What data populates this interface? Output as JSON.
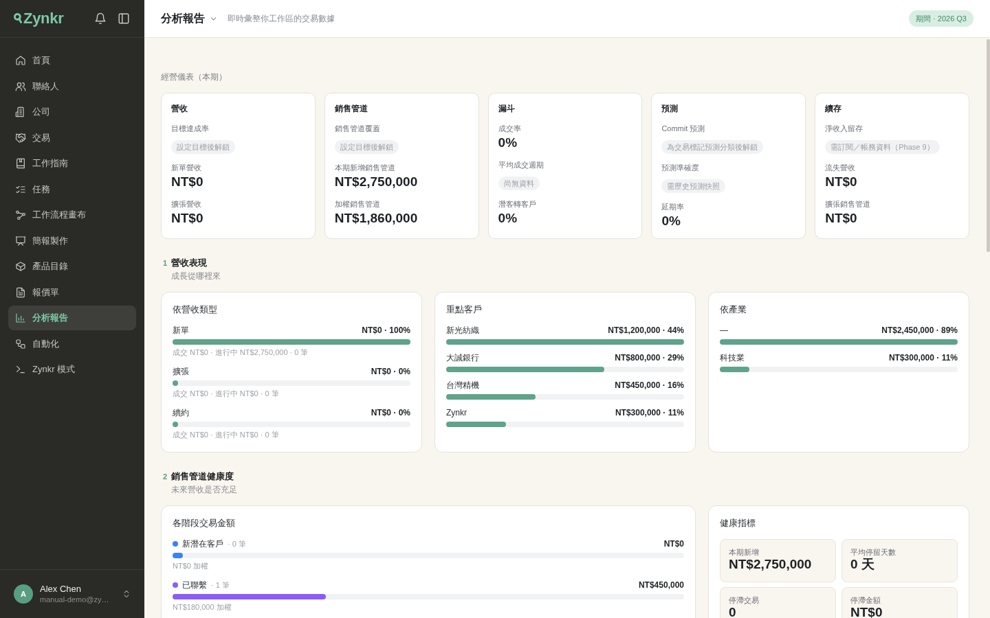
{
  "sidebar": {
    "logo": "Zynkr",
    "items": [
      {
        "label": "首頁",
        "selected": false
      },
      {
        "label": "聯絡人",
        "selected": false
      },
      {
        "label": "公司",
        "selected": false
      },
      {
        "label": "交易",
        "selected": false
      },
      {
        "label": "工作指南",
        "selected": false
      },
      {
        "label": "任務",
        "selected": false
      },
      {
        "label": "工作流程畫布",
        "selected": false
      },
      {
        "label": "簡報製作",
        "selected": false
      },
      {
        "label": "產品目錄",
        "selected": false
      },
      {
        "label": "報價單",
        "selected": false
      },
      {
        "label": "分析報告",
        "selected": true
      },
      {
        "label": "自動化",
        "selected": false
      },
      {
        "label": "Zynkr 模式",
        "selected": false
      }
    ],
    "user": {
      "initial": "A",
      "name": "Alex Chen",
      "email": "manual-demo@zy…"
    }
  },
  "header": {
    "title": "分析報告",
    "subtitle": "即時彙整你工作區的交易數據",
    "period": "期間 · 2026 Q3"
  },
  "overview": {
    "heading": "經營儀表（本期）",
    "cards": [
      {
        "title": "營收",
        "metrics": [
          {
            "kind": "locked",
            "label": "目標達成率",
            "value": "設定目標後解鎖"
          },
          {
            "kind": "value",
            "label": "新單營收",
            "value": "NT$0"
          },
          {
            "kind": "value",
            "label": "擴張營收",
            "value": "NT$0"
          }
        ]
      },
      {
        "title": "銷售管道",
        "metrics": [
          {
            "kind": "locked",
            "label": "銷售管道覆蓋",
            "value": "設定目標後解鎖"
          },
          {
            "kind": "value",
            "label": "本期新增銷售管道",
            "value": "NT$2,750,000"
          },
          {
            "kind": "value",
            "label": "加權銷售管道",
            "value": "NT$1,860,000"
          }
        ]
      },
      {
        "title": "漏斗",
        "metrics": [
          {
            "kind": "value",
            "label": "成交率",
            "value": "0%"
          },
          {
            "kind": "locked",
            "label": "平均成交週期",
            "value": "尚無資料"
          },
          {
            "kind": "value",
            "label": "潛客轉客戶",
            "value": "0%"
          }
        ]
      },
      {
        "title": "預測",
        "metrics": [
          {
            "kind": "locked",
            "label": "Commit 預測",
            "value": "為交易標記預測分類後解鎖"
          },
          {
            "kind": "locked",
            "label": "預測準確度",
            "value": "需歷史預測快照"
          },
          {
            "kind": "value",
            "label": "延期率",
            "value": "0%"
          }
        ]
      },
      {
        "title": "續存",
        "metrics": [
          {
            "kind": "locked",
            "label": "淨收入留存",
            "value": "需訂閱／帳務資料（Phase 9）"
          },
          {
            "kind": "value",
            "label": "流失營收",
            "value": "NT$0"
          },
          {
            "kind": "value",
            "label": "擴張銷售管道",
            "value": "NT$0"
          }
        ]
      }
    ]
  },
  "sections": [
    {
      "number": "1",
      "title": "營收表現",
      "subtitle": "成長從哪裡來",
      "panels": [
        {
          "kind": "bars",
          "title": "依營收類型",
          "rows": [
            {
              "label": "新單",
              "value": "NT$0 · 100%",
              "level": 1,
              "note": "成交 NT$0 · 進行中 NT$2,750,000 · 0 筆"
            },
            {
              "label": "擴張",
              "value": "NT$0 · 0%",
              "level": 0,
              "note": "成交 NT$0 · 進行中 NT$0 · 0 筆"
            },
            {
              "label": "續約",
              "value": "NT$0 · 0%",
              "level": 0,
              "note": "成交 NT$0 · 進行中 NT$0 · 0 筆"
            }
          ]
        },
        {
          "kind": "bars",
          "title": "重點客戶",
          "rows": [
            {
              "label": "新光紡織",
              "value": "NT$1,200,000 · 44%",
              "level": 1
            },
            {
              "label": "大誠銀行",
              "value": "NT$800,000 · 29%",
              "level": 0.665
            },
            {
              "label": "台灣精機",
              "value": "NT$450,000 · 16%",
              "level": 0.375
            },
            {
              "label": "Zynkr",
              "value": "NT$300,000 · 11%",
              "level": 0.25
            }
          ]
        },
        {
          "kind": "bars",
          "title": "依產業",
          "rows": [
            {
              "label": "—",
              "value": "NT$2,450,000 · 89%",
              "level": 1
            },
            {
              "label": "科技業",
              "value": "NT$300,000 · 11%",
              "level": 0.124
            }
          ]
        }
      ]
    },
    {
      "number": "2",
      "title": "銷售管道健康度",
      "subtitle": "未來營收是否充足",
      "panels": [
        {
          "kind": "stages",
          "title": "各階段交易金額",
          "rows": [
            {
              "label": "新潛在客戶",
              "count": "· 0 筆",
              "value": "NT$0",
              "level": 0.02,
              "color": "#3b82f6",
              "note": "NT$0 加權"
            },
            {
              "label": "已聯繫",
              "count": "· 1 筆",
              "value": "NT$450,000",
              "level": 0.3,
              "color": "#8b5cf6",
              "note": "NT$180,000 加權"
            }
          ]
        },
        {
          "kind": "tiles",
          "title": "健康指標",
          "tiles": [
            {
              "label": "本期新增",
              "value": "NT$2,750,000"
            },
            {
              "label": "平均停留天數",
              "value": "0 天"
            },
            {
              "label": "停滯交易",
              "value": "0"
            },
            {
              "label": "停滯金額",
              "value": "NT$0"
            }
          ]
        }
      ]
    }
  ]
}
